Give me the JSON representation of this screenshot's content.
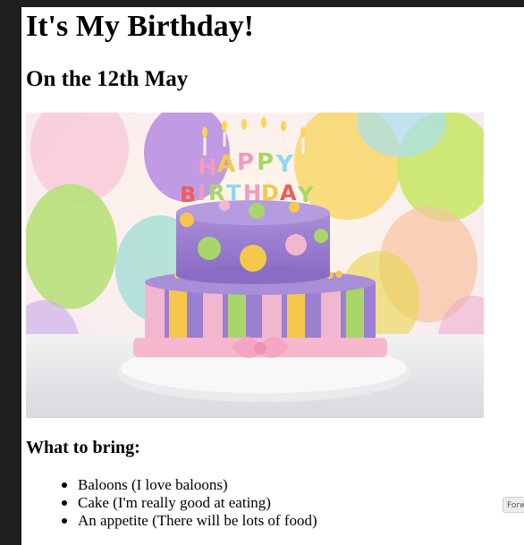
{
  "page": {
    "title": "It's My Birthday!",
    "subtitle": "On the 12th May",
    "section_heading": "What to bring:"
  },
  "bring_list": [
    {
      "text": "Baloons (I love baloons)"
    },
    {
      "text": "Cake (I'm really good at eating)"
    },
    {
      "text": "An appetite (There will be lots of food)"
    }
  ],
  "photo": {
    "candle_letters_top": "HAPPY",
    "candle_letters_bottom": "BIRTHDAY"
  },
  "forward_button": {
    "label": "Forw"
  },
  "colors": {
    "page_bg": "#ffffff",
    "outer_bg": "#1e1e1e",
    "cake_purple": "#9b7fd1",
    "cake_yellow": "#f5c84c",
    "cake_green": "#a8d66b",
    "cake_pink": "#f3b6cf"
  }
}
